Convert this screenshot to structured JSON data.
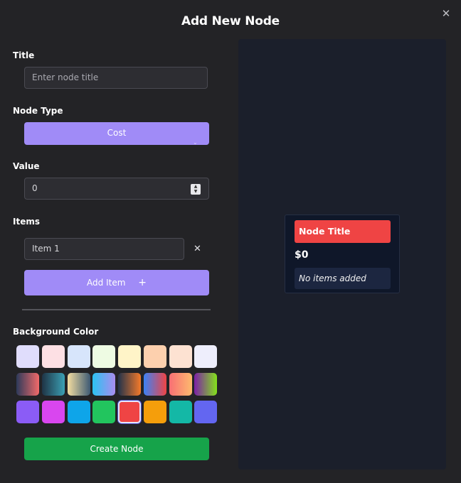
{
  "modal": {
    "title": "Add New Node",
    "close_icon": "✕"
  },
  "form": {
    "title_label": "Title",
    "title_placeholder": "Enter node title",
    "node_type_label": "Node Type",
    "node_type_selected": "Cost",
    "value_label": "Value",
    "value": "0",
    "items_label": "Items",
    "items": [
      {
        "value": "Item 1"
      }
    ],
    "remove_icon": "✕",
    "add_item_label": "Add Item",
    "add_icon": "+",
    "background_label": "Background Color",
    "create_label": "Create Node"
  },
  "swatches": {
    "selected": "#ef4444",
    "colors": [
      [
        "#e0ddfc",
        "#fde0e4",
        "#d7e5fb",
        "#eefbe3",
        "#fff4c8",
        "#fdd0ae",
        "#fde2d2",
        "#eeeefc"
      ],
      [
        "linear-gradient(90deg,#2d3a5a,#f26a6a)",
        "linear-gradient(90deg,#1f3345,#3ba0b4)",
        "linear-gradient(90deg,#f3dda0,#3d5a74)",
        "linear-gradient(90deg,#2bc3f2,#a98df0)",
        "linear-gradient(90deg,#22324a,#f47a2a)",
        "linear-gradient(90deg,#3b82f6,#ef4444)",
        "linear-gradient(90deg,#f86f74,#fdba6e)",
        "linear-gradient(90deg,#7c1fa8,#84e11b)"
      ],
      [
        "#8b5cf6",
        "#d946ef",
        "#0ea5e9",
        "#22c55e",
        "#ef4444",
        "#f59e0b",
        "#14b8a6",
        "#6366f1"
      ]
    ]
  },
  "preview": {
    "node_title": "Node Title",
    "node_value": "$0",
    "no_items": "No items added",
    "title_color": "#ef4444"
  }
}
